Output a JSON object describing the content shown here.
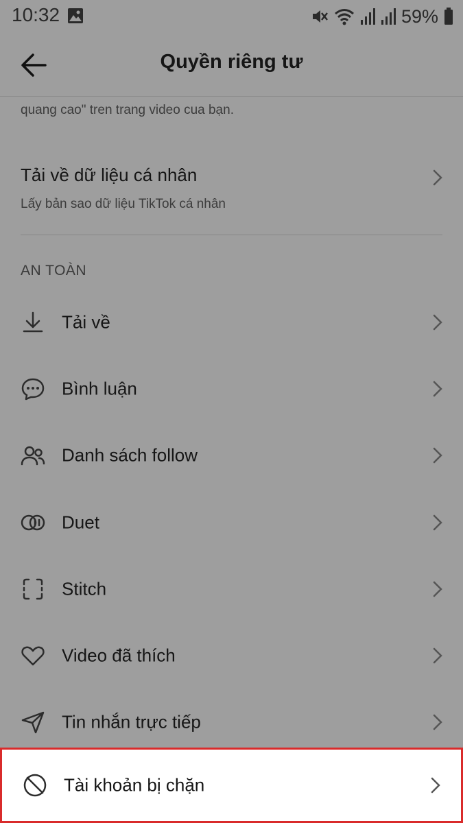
{
  "status_bar": {
    "time": "10:32",
    "battery": "59%"
  },
  "header": {
    "title": "Quyền riêng tư"
  },
  "clipped_text": "quang cao\" tren trang video cua bạn.",
  "download_data": {
    "title": "Tải về dữ liệu cá nhân",
    "subtitle": "Lấy bản sao dữ liệu TikTok cá nhân"
  },
  "section": {
    "label": "AN TOÀN"
  },
  "menu": {
    "items": [
      {
        "label": "Tải về",
        "icon": "download-icon"
      },
      {
        "label": "Bình luận",
        "icon": "comment-icon"
      },
      {
        "label": "Danh sách follow",
        "icon": "people-icon"
      },
      {
        "label": "Duet",
        "icon": "duet-icon"
      },
      {
        "label": "Stitch",
        "icon": "stitch-icon"
      },
      {
        "label": "Video đã thích",
        "icon": "heart-icon"
      },
      {
        "label": "Tin nhắn trực tiếp",
        "icon": "send-icon"
      },
      {
        "label": "Tài khoản bị chặn",
        "icon": "blocked-icon"
      }
    ]
  },
  "colors": {
    "overlay": "#9e9e9e",
    "highlight_border": "#d92b2b"
  }
}
